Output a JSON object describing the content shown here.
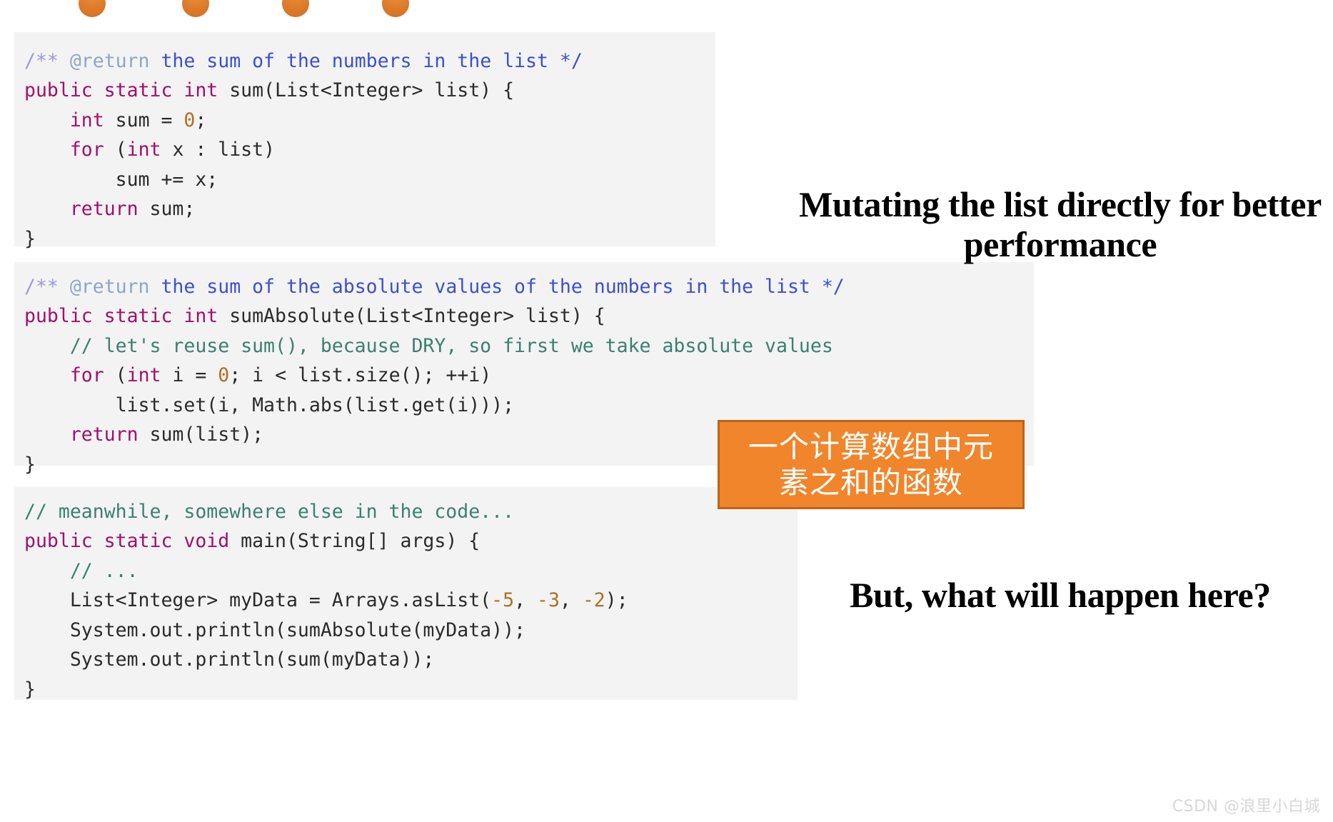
{
  "bullets": {
    "color": "#df7f2c",
    "positions": [
      110,
      255,
      395,
      535
    ]
  },
  "code_blocks": [
    {
      "id": "sum-method",
      "lines": [
        [
          {
            "t": "/** ",
            "c": "jdoc"
          },
          {
            "t": "@return",
            "c": "jdoc-tag"
          },
          {
            "t": " the sum of the numbers in the list */",
            "c": "jdoc-text"
          }
        ],
        [
          {
            "t": "public static int ",
            "c": "kw"
          },
          {
            "t": "sum(List<Integer> list) {",
            "c": "plain"
          }
        ],
        [
          {
            "t": "    ",
            "c": "plain"
          },
          {
            "t": "int ",
            "c": "kw"
          },
          {
            "t": "sum = ",
            "c": "plain"
          },
          {
            "t": "0",
            "c": "num"
          },
          {
            "t": ";",
            "c": "plain"
          }
        ],
        [
          {
            "t": "    ",
            "c": "plain"
          },
          {
            "t": "for ",
            "c": "kw"
          },
          {
            "t": "(",
            "c": "plain"
          },
          {
            "t": "int ",
            "c": "kw"
          },
          {
            "t": "x : list)",
            "c": "plain"
          }
        ],
        [
          {
            "t": "        sum += x;",
            "c": "plain"
          }
        ],
        [
          {
            "t": "    ",
            "c": "plain"
          },
          {
            "t": "return ",
            "c": "kw"
          },
          {
            "t": "sum;",
            "c": "plain"
          }
        ],
        [
          {
            "t": "}",
            "c": "plain"
          }
        ]
      ]
    },
    {
      "id": "sumabsolute-method",
      "lines": [
        [
          {
            "t": "/** ",
            "c": "jdoc"
          },
          {
            "t": "@return",
            "c": "jdoc-tag"
          },
          {
            "t": " the sum of the absolute values of the numbers in the list */",
            "c": "jdoc-text"
          }
        ],
        [
          {
            "t": "public static int ",
            "c": "kw"
          },
          {
            "t": "sumAbsolute(List<Integer> list) {",
            "c": "plain"
          }
        ],
        [
          {
            "t": "    ",
            "c": "plain"
          },
          {
            "t": "// let's reuse sum(), because DRY, so first we take absolute values",
            "c": "comment"
          }
        ],
        [
          {
            "t": "    ",
            "c": "plain"
          },
          {
            "t": "for ",
            "c": "kw"
          },
          {
            "t": "(",
            "c": "plain"
          },
          {
            "t": "int ",
            "c": "kw"
          },
          {
            "t": "i = ",
            "c": "plain"
          },
          {
            "t": "0",
            "c": "num"
          },
          {
            "t": "; i < list.size(); ++i)",
            "c": "plain"
          }
        ],
        [
          {
            "t": "        list.set(i, Math.abs(list.get(i)));",
            "c": "plain"
          }
        ],
        [
          {
            "t": "    ",
            "c": "plain"
          },
          {
            "t": "return ",
            "c": "kw"
          },
          {
            "t": "sum(list);",
            "c": "plain"
          }
        ],
        [
          {
            "t": "}",
            "c": "plain"
          }
        ]
      ]
    },
    {
      "id": "main-method",
      "lines": [
        [
          {
            "t": "// meanwhile, somewhere else in the code...",
            "c": "comment"
          }
        ],
        [
          {
            "t": "public static void ",
            "c": "kw"
          },
          {
            "t": "main(String[] args) {",
            "c": "plain"
          }
        ],
        [
          {
            "t": "    ",
            "c": "plain"
          },
          {
            "t": "// ...",
            "c": "comment"
          }
        ],
        [
          {
            "t": "    List<Integer> myData = Arrays.asList(",
            "c": "plain"
          },
          {
            "t": "-5",
            "c": "num"
          },
          {
            "t": ", ",
            "c": "plain"
          },
          {
            "t": "-3",
            "c": "num"
          },
          {
            "t": ", ",
            "c": "plain"
          },
          {
            "t": "-2",
            "c": "num"
          },
          {
            "t": ");",
            "c": "plain"
          }
        ],
        [
          {
            "t": "    System.out.println(sumAbsolute(myData));",
            "c": "plain"
          }
        ],
        [
          {
            "t": "    System.out.println(sum(myData));",
            "c": "plain"
          }
        ],
        [
          {
            "t": "}",
            "c": "plain"
          }
        ]
      ]
    }
  ],
  "captions": {
    "mutating": "Mutating the list directly for better performance",
    "question": "But, what will happen here?"
  },
  "annotation": {
    "text": "一个计算数组中元\n素之和的函数",
    "fill_color": "#f0852b",
    "border_color": "#b9651b",
    "text_color": "#ffffff"
  },
  "watermark": {
    "text": "CSDN @浪里小白城"
  }
}
